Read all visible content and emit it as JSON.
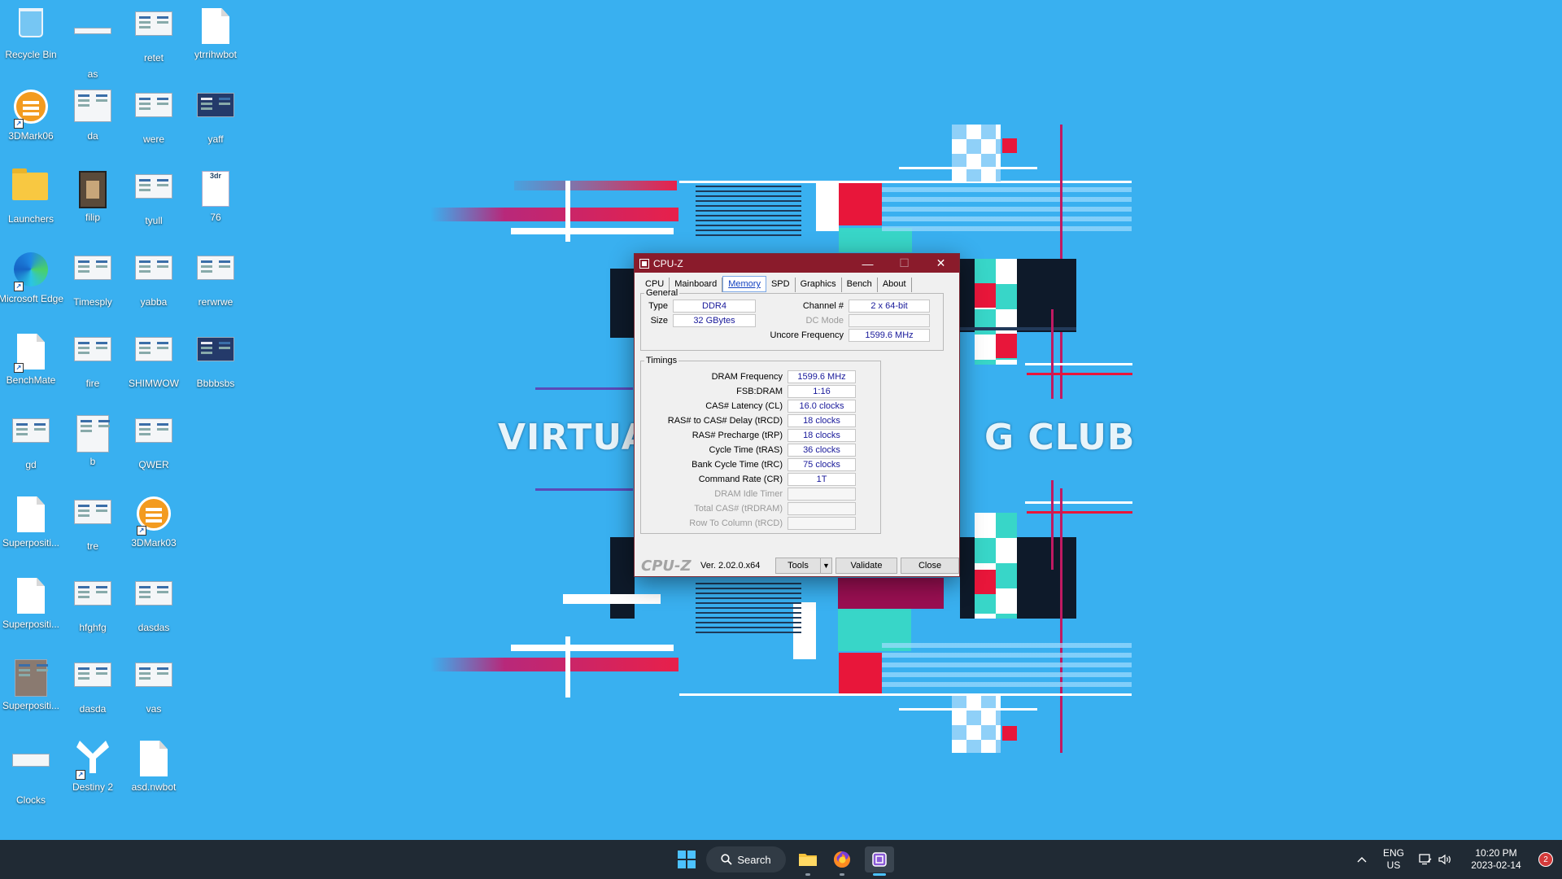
{
  "wallpaper": {
    "title_left": "VIRTUALC",
    "title_right": "G CLUB"
  },
  "desktop": {
    "icons": [
      {
        "label": "Recycle Bin"
      },
      {
        "label": "as"
      },
      {
        "label": "retet"
      },
      {
        "label": "ytrrihwbot"
      },
      {
        "label": "3DMark06"
      },
      {
        "label": "da"
      },
      {
        "label": "were"
      },
      {
        "label": "yaff"
      },
      {
        "label": "Launchers"
      },
      {
        "label": "filip"
      },
      {
        "label": "tyull"
      },
      {
        "label": "76"
      },
      {
        "label": "Microsoft Edge"
      },
      {
        "label": "Timesply"
      },
      {
        "label": "yabba"
      },
      {
        "label": "rerwrwe"
      },
      {
        "label": "BenchMate"
      },
      {
        "label": "fire"
      },
      {
        "label": "SHIMWOW"
      },
      {
        "label": "Bbbbsbs"
      },
      {
        "label": "gd"
      },
      {
        "label": "b"
      },
      {
        "label": "QWER"
      },
      {
        "label": "Superpositi..."
      },
      {
        "label": "tre"
      },
      {
        "label": "3DMark03"
      },
      {
        "label": "Superpositi..."
      },
      {
        "label": "hfghfg"
      },
      {
        "label": "dasdas"
      },
      {
        "label": "Superpositi..."
      },
      {
        "label": "dasda"
      },
      {
        "label": "vas"
      },
      {
        "label": "Clocks"
      },
      {
        "label": "Destiny 2"
      },
      {
        "label": "asd.nwbot"
      }
    ]
  },
  "cpuz": {
    "title": "CPU-Z",
    "controls": {
      "minimize": "—",
      "maximize": "☐",
      "close": "✕"
    },
    "tabs": [
      "CPU",
      "Mainboard",
      "Memory",
      "SPD",
      "Graphics",
      "Bench",
      "About"
    ],
    "general": {
      "legend": "General",
      "type_label": "Type",
      "type_value": "DDR4",
      "size_label": "Size",
      "size_value": "32 GBytes",
      "channel_label": "Channel #",
      "channel_value": "2 x 64-bit",
      "dcmode_label": "DC Mode",
      "dcmode_value": "",
      "uncore_label": "Uncore Frequency",
      "uncore_value": "1599.6 MHz"
    },
    "timings": {
      "legend": "Timings",
      "rows": [
        {
          "label": "DRAM Frequency",
          "value": "1599.6 MHz"
        },
        {
          "label": "FSB:DRAM",
          "value": "1:16"
        },
        {
          "label": "CAS# Latency (CL)",
          "value": "16.0 clocks"
        },
        {
          "label": "RAS# to CAS# Delay (tRCD)",
          "value": "18 clocks"
        },
        {
          "label": "RAS# Precharge (tRP)",
          "value": "18 clocks"
        },
        {
          "label": "Cycle Time (tRAS)",
          "value": "36 clocks"
        },
        {
          "label": "Bank Cycle Time (tRC)",
          "value": "75 clocks"
        },
        {
          "label": "Command Rate (CR)",
          "value": "1T"
        },
        {
          "label": "DRAM Idle Timer",
          "value": ""
        },
        {
          "label": "Total CAS# (tRDRAM)",
          "value": ""
        },
        {
          "label": "Row To Column (tRCD)",
          "value": ""
        }
      ]
    },
    "footer": {
      "brand": "CPU-Z",
      "version": "Ver. 2.02.0.x64",
      "tools": "Tools",
      "validate": "Validate",
      "close": "Close"
    }
  },
  "taskbar": {
    "search_label": "Search",
    "lang_line1": "ENG",
    "lang_line2": "US",
    "time": "10:20 PM",
    "date": "2023-02-14",
    "notifications": "2",
    "accent": "#4cc2ff"
  }
}
